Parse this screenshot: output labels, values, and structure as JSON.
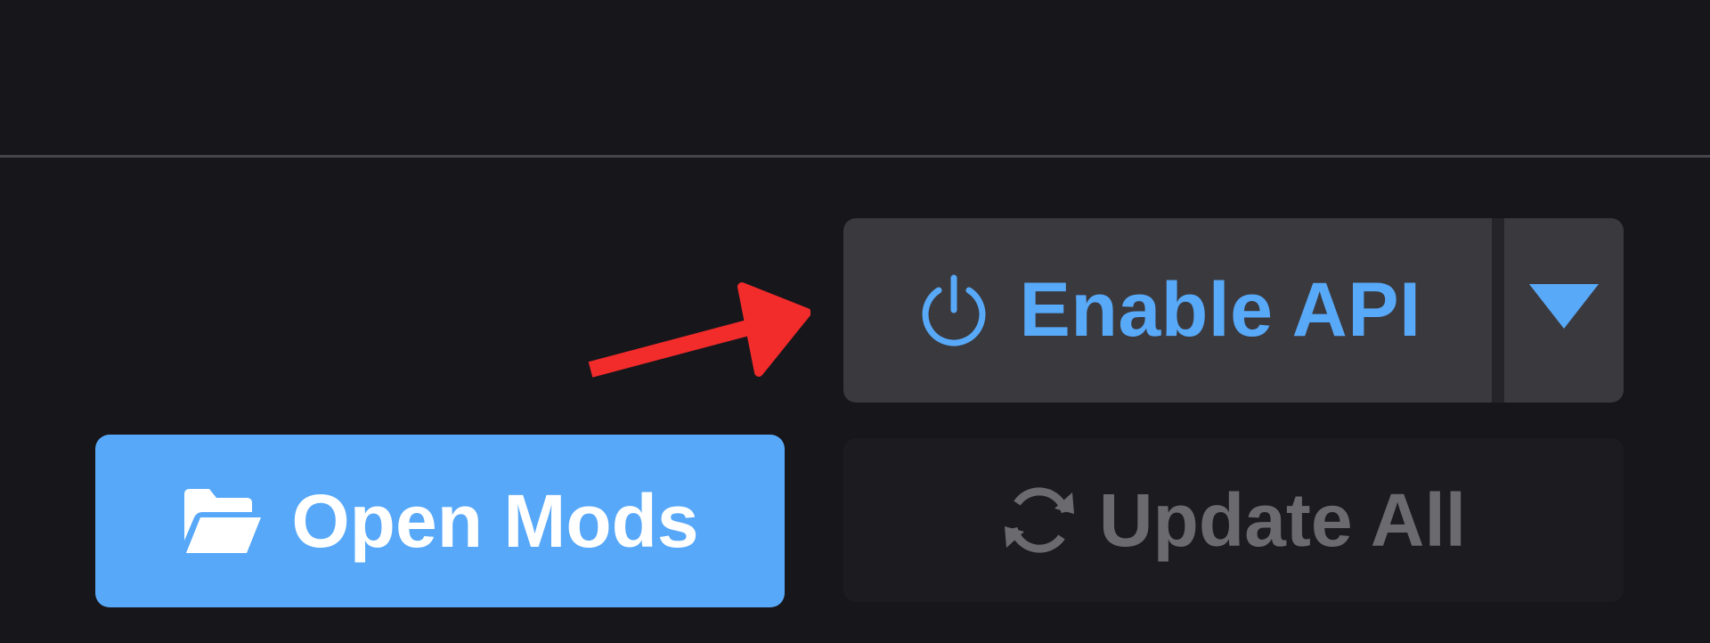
{
  "toolbar": {
    "enable_api_label": "Enable API",
    "enable_api_icon": "power-icon",
    "dropdown_icon": "caret-down-icon",
    "open_mods_label": "Open Mods",
    "open_mods_icon": "folder-open-icon",
    "update_all_label": "Update All",
    "update_all_icon": "refresh-icon",
    "update_all_disabled": true
  },
  "colors": {
    "background": "#17161b",
    "accent": "#57a8f9",
    "button_dark": "#3a393e",
    "disabled_text": "#6b6a6e",
    "annotation_arrow": "#f22b2b"
  }
}
